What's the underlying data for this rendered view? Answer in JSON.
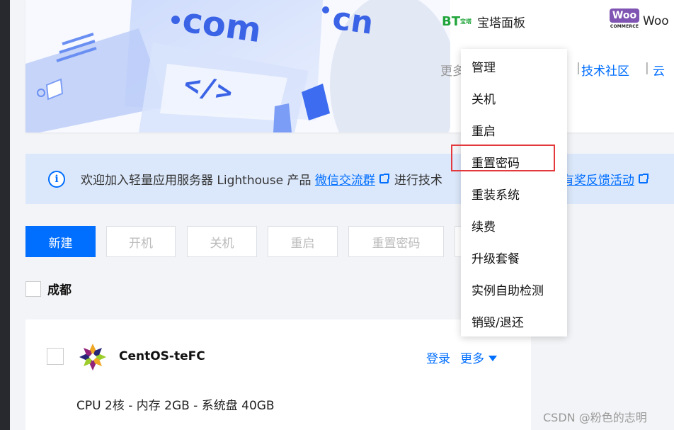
{
  "banner": {
    "art_text_domain": "com",
    "art_text_cn": "cn",
    "art_text_code": "</>",
    "bt": {
      "mark": "BT",
      "mark_small": "宝塔",
      "name": "宝塔面板"
    },
    "woo": {
      "mark": "Woo",
      "sub": "COMMERCE",
      "name": "Woo"
    },
    "more_prefix": "更多",
    "link_mid": "",
    "link_community": "技术社区",
    "link_cloud": "云"
  },
  "notice": {
    "text_prefix": "欢迎加入轻量应用服务器 Lighthouse 产品",
    "link_wechat": "微信交流群",
    "text_mid": "进行技术",
    "link_feedback": "与有奖反馈活动"
  },
  "toolbar": {
    "create": "新建",
    "start": "开机",
    "shutdown": "关机",
    "restart": "重启",
    "reset_password": "重置密码"
  },
  "region": {
    "label": "成都"
  },
  "instance": {
    "name": "CentOS-teFC",
    "login": "登录",
    "more": "更多",
    "specs": "CPU 2核 - 内存 2GB - 系统盘 40GB"
  },
  "menu": {
    "items": [
      "管理",
      "关机",
      "重启",
      "重置密码",
      "重装系统",
      "续费",
      "升级套餐",
      "实例自助检测",
      "销毁/退还"
    ],
    "highlighted_index": 3
  },
  "watermark": "CSDN @粉色的志明",
  "colors": {
    "primary": "#006eff",
    "highlight": "#e4393c",
    "bt_green": "#20a53a",
    "woo_purple": "#7f54b3"
  }
}
